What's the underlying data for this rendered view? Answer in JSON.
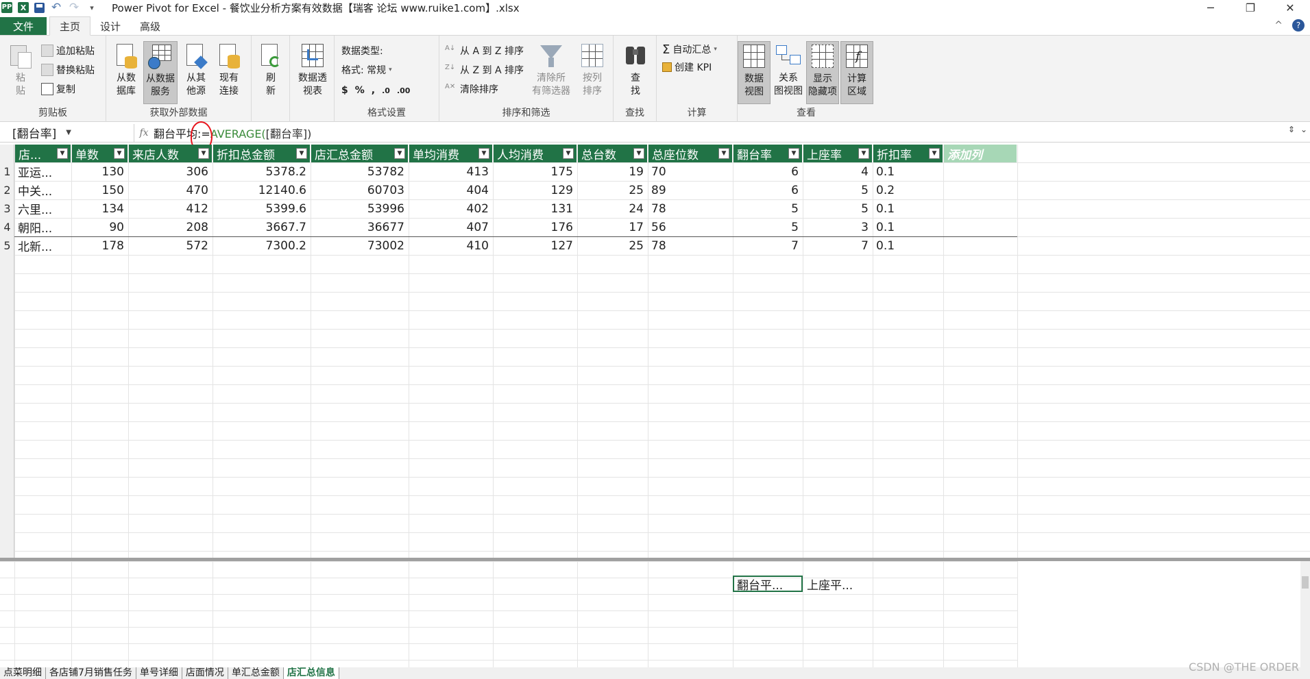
{
  "window": {
    "title": "Power Pivot for Excel - 餐饮业分析方案有效数据【瑞客 论坛 www.ruike1.com】.xlsx",
    "controls": {
      "minimize": "─",
      "restore": "❐",
      "close": "✕"
    }
  },
  "quick_access": {
    "pp_icon": "PP",
    "excel_icon": "X",
    "undo": "↶",
    "redo": "↷",
    "customize": "▾"
  },
  "ribbon_tabs": [
    {
      "label": "文件",
      "active": false
    },
    {
      "label": "主页",
      "active": true
    },
    {
      "label": "设计",
      "active": false
    },
    {
      "label": "高级",
      "active": false
    }
  ],
  "ribbon_right": {
    "collapse": "^",
    "help": "?"
  },
  "ribbon": {
    "clipboard": {
      "label": "剪贴板",
      "paste": "粘\n贴",
      "paste_append": "追加粘贴",
      "paste_replace": "替换粘贴",
      "copy": "复制"
    },
    "get_external": {
      "label": "获取外部数据",
      "from_db": "从数\n据库",
      "from_service": "从数据\n服务",
      "from_other": "从其\n他源",
      "existing": "现有\n连接"
    },
    "refresh": {
      "label": "刷\n新"
    },
    "pivot": {
      "label": "数据透\n视表"
    },
    "format": {
      "label": "格式设置",
      "data_type": "数据类型:",
      "format": "格式: 常规",
      "currency": "$",
      "percent": "%",
      "comma": ",",
      "inc_dec": ".0",
      "dec_dec": ".00"
    },
    "sort": {
      "label": "排序和筛选",
      "az": "从 A 到 Z 排序",
      "za": "从 Z 到 A 排序",
      "clear_sort": "清除排序",
      "clear_filters": "清除所\n有筛选器",
      "sort_by_col": "按列\n排序"
    },
    "find": {
      "label": "查找",
      "btn": "查\n找"
    },
    "calc": {
      "label": "计算",
      "autosum": "自动汇总",
      "kpi": "创建 KPI"
    },
    "view": {
      "label": "查看",
      "data_view": "数据\n视图",
      "diagram_view": "关系\n图视图",
      "show_hidden": "显示\n隐藏项",
      "calc_area": "计算\n区域"
    }
  },
  "formula_bar": {
    "name_box": "[翻台率]",
    "fx": "fx",
    "formula_name": "翻台平均:=",
    "formula_fn": "AVERAGE(",
    "formula_ref": "[翻台率])"
  },
  "table": {
    "columns": [
      "店...",
      "单数",
      "来店人数",
      "折扣总金额",
      "店汇总金额",
      "单均消费",
      "人均消费",
      "总台数",
      "总座位数",
      "翻台率",
      "上座率",
      "折扣率"
    ],
    "add_column": "添加列",
    "rows": [
      [
        "亚运...",
        "130",
        "306",
        "5378.2",
        "53782",
        "413",
        "175",
        "19",
        "70",
        "6",
        "4",
        "0.1"
      ],
      [
        "中关...",
        "150",
        "470",
        "12140.6",
        "60703",
        "404",
        "129",
        "25",
        "89",
        "6",
        "5",
        "0.2"
      ],
      [
        "六里...",
        "134",
        "412",
        "5399.6",
        "53996",
        "402",
        "131",
        "24",
        "78",
        "5",
        "5",
        "0.1"
      ],
      [
        "朝阳...",
        "90",
        "208",
        "3667.7",
        "36677",
        "407",
        "176",
        "17",
        "56",
        "5",
        "3",
        "0.1"
      ],
      [
        "北新...",
        "178",
        "572",
        "7300.2",
        "73002",
        "410",
        "127",
        "25",
        "78",
        "7",
        "7",
        "0.1"
      ]
    ]
  },
  "measures": [
    "翻台平...",
    "上座平..."
  ],
  "sheet_tabs": [
    {
      "label": "点菜明细",
      "active": false
    },
    {
      "label": "各店铺7月销售任务",
      "active": false
    },
    {
      "label": "单号详细",
      "active": false
    },
    {
      "label": "店面情况",
      "active": false
    },
    {
      "label": "单汇总金额",
      "active": false
    },
    {
      "label": "店汇总信息",
      "active": true
    }
  ],
  "watermark": "CSDN @THE ORDER"
}
